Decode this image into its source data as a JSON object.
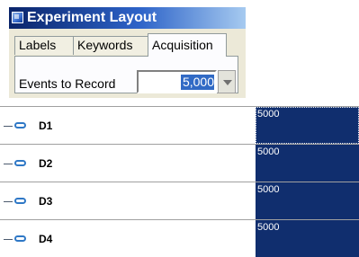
{
  "window": {
    "title": "Experiment Layout",
    "icon": "app-window-icon"
  },
  "tabs": [
    {
      "label": "Labels",
      "active": false
    },
    {
      "label": "Keywords",
      "active": false
    },
    {
      "label": "Acquisition",
      "active": true
    }
  ],
  "acquisition": {
    "events_label": "Events to Record",
    "events_value": "5,000"
  },
  "grid": {
    "rows": [
      {
        "name": "D1",
        "value": "5000",
        "icon": "tube-icon"
      },
      {
        "name": "D2",
        "value": "5000",
        "icon": "tube-icon"
      },
      {
        "name": "D3",
        "value": "5000",
        "icon": "tube-icon"
      },
      {
        "name": "D4",
        "value": "5000",
        "icon": "tube-icon"
      }
    ]
  },
  "colors": {
    "title_bar": "#0a246a",
    "selection": "#102e6e",
    "tube_icon": "#2f78c6"
  }
}
